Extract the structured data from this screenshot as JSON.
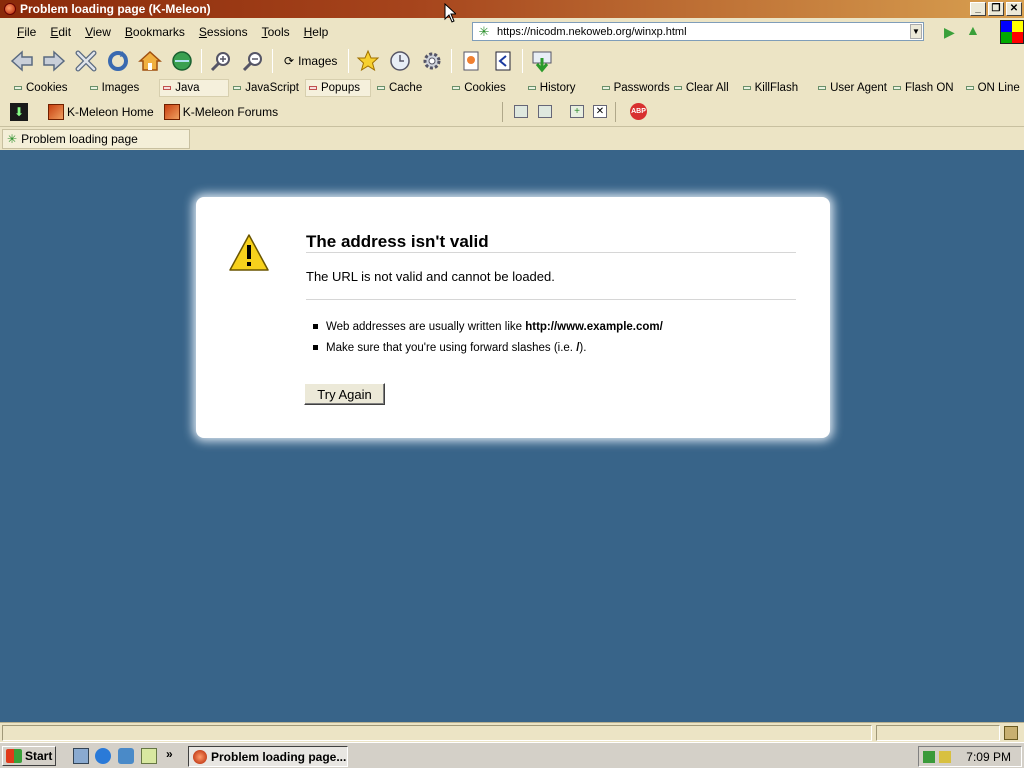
{
  "window": {
    "title": "Problem loading page (K-Meleon)",
    "caption_buttons": [
      "_",
      "❐",
      "✕"
    ]
  },
  "menu": [
    "File",
    "Edit",
    "View",
    "Bookmarks",
    "Sessions",
    "Tools",
    "Help"
  ],
  "menu_access_keys": [
    "F",
    "E",
    "V",
    "B",
    "S",
    "T",
    "H"
  ],
  "address": {
    "url": "https://nicodm.nekoweb.org/winxp.html"
  },
  "toolbar": {
    "images_label": "Images"
  },
  "privacy_bar": [
    "Cookies",
    "Images",
    "Java",
    "JavaScript",
    "Popups",
    "Cache",
    "Cookies",
    "History",
    "Passwords",
    "Clear All",
    "KillFlash",
    "User Agent",
    "Flash ON",
    "ON Line"
  ],
  "links": [
    "K-Meleon Home",
    "K-Meleon Forums"
  ],
  "tab": {
    "title": "Problem loading page"
  },
  "error": {
    "title": "The address isn't valid",
    "description": "The URL is not valid and cannot be loaded.",
    "tip1_prefix": "Web addresses are usually written like ",
    "tip1_bold": "http://www.example.com/",
    "tip2_prefix": "Make sure that you're using forward slashes (i.e. ",
    "tip2_bold": "/",
    "tip2_suffix": ").",
    "button": "Try Again"
  },
  "taskbar": {
    "start": "Start",
    "task": "Problem loading page...",
    "clock": "7:09 PM",
    "chevron": "»"
  },
  "colors": {
    "content_bg": "#386489",
    "chrome_bg": "#ECE4C5"
  }
}
